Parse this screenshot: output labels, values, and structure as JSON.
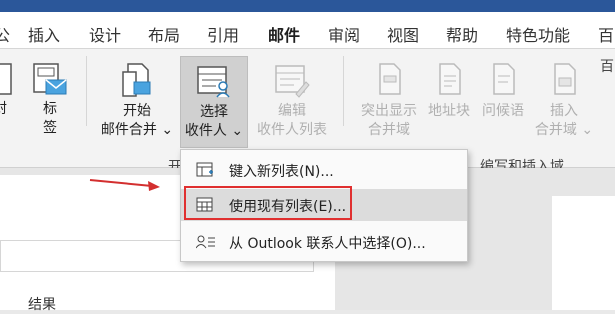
{
  "tabs": [
    {
      "label": "公"
    },
    {
      "label": "插入"
    },
    {
      "label": "设计"
    },
    {
      "label": "布局"
    },
    {
      "label": "引用"
    },
    {
      "label": "邮件",
      "active": true
    },
    {
      "label": "审阅"
    },
    {
      "label": "视图"
    },
    {
      "label": "帮助"
    },
    {
      "label": "特色功能"
    },
    {
      "label": "百"
    }
  ],
  "ribbon": {
    "envelope_label": "封",
    "labels_label_1": "标",
    "labels_label_2": "签",
    "start_merge_1": "开始",
    "start_merge_2": "邮件合并 ⌄",
    "select_recipients_1": "选择",
    "select_recipients_2": "收件人 ⌄",
    "edit_recipients_1": "编辑",
    "edit_recipients_2": "收件人列表",
    "highlight_fields_1": "突出显示",
    "highlight_fields_2": "合并域",
    "address_block": "地址块",
    "greeting_line": "问候语",
    "insert_field_1": "插入",
    "insert_field_2": "合并域 ⌄",
    "group_start": "开",
    "group_write": "编写和插入域",
    "right_clip": "百"
  },
  "menu": {
    "items": [
      {
        "label": "键入新列表(N)..."
      },
      {
        "label": "使用现有列表(E)...",
        "highlighted": true
      },
      {
        "label": "从 Outlook 联系人中选择(O)..."
      }
    ]
  },
  "doc": {
    "result_label": "结果"
  },
  "colors": {
    "accent": "#2b579a",
    "highlight_border": "#e03030",
    "arrow": "#d32f2f"
  }
}
